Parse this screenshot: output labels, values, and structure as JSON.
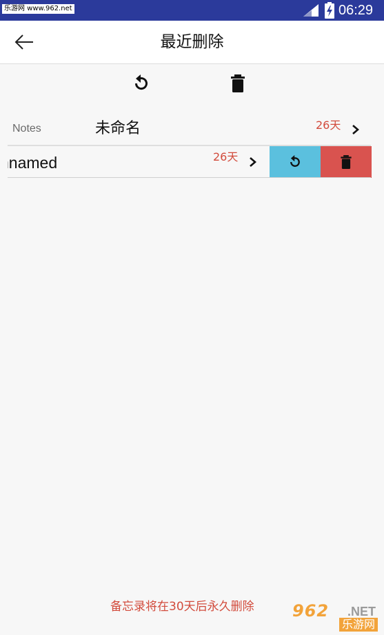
{
  "status_bar": {
    "watermark_text": "乐游网 www.962.net",
    "time": "06:29",
    "background": "#2b3a9b"
  },
  "app_bar": {
    "title": "最近删除",
    "back_icon": "arrow-left-icon"
  },
  "toolbar": {
    "restore_icon": "restore-icon",
    "delete_icon": "trash-icon"
  },
  "notes": [
    {
      "folder": "Notes",
      "title": "未命名",
      "days_left": "26天"
    },
    {
      "title": "nnamed",
      "days_left": "26天",
      "swipe_actions": {
        "restore_icon": "restore-icon",
        "restore_color": "#5bc0de",
        "delete_icon": "trash-icon",
        "delete_color": "#d9534f"
      }
    }
  ],
  "footer": {
    "note": "备忘录将在30天后永久删除"
  },
  "watermark_logo": {
    "main": "962",
    "suffix": ".NET",
    "sub": "乐游网"
  },
  "colors": {
    "accent_red": "#d24b3c",
    "status_bar": "#2b3a9b"
  }
}
